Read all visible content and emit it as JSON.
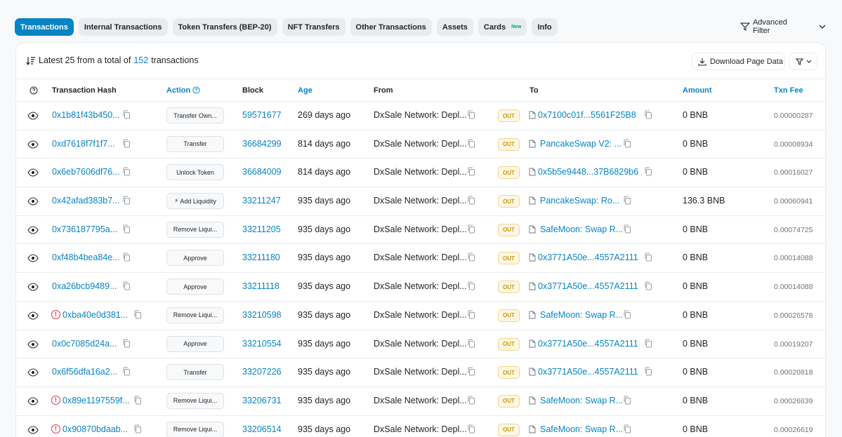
{
  "tabs": [
    {
      "label": "Transactions",
      "active": true
    },
    {
      "label": "Internal Transactions"
    },
    {
      "label": "Token Transfers (BEP-20)"
    },
    {
      "label": "NFT Transfers"
    },
    {
      "label": "Other Transactions"
    },
    {
      "label": "Assets"
    },
    {
      "label": "Cards",
      "badge": "New"
    },
    {
      "label": "Info"
    }
  ],
  "advanced_filter_label": "Advanced Filter",
  "summary": {
    "prefix": "Latest 25 from a total of",
    "count": "152",
    "suffix": "transactions"
  },
  "download_label": "Download Page Data",
  "columns": {
    "hash": "Transaction Hash",
    "action": "Action",
    "block": "Block",
    "age": "Age",
    "from": "From",
    "to": "To",
    "amount": "Amount",
    "fee": "Txn Fee"
  },
  "rows": [
    {
      "hash": "0x1b81f43b450...",
      "error": false,
      "action": "Transfer Own...",
      "block": "59571677",
      "age": "269 days ago",
      "from": "DxSale Network: Depl...",
      "direction": "OUT",
      "to": "0x7100c01f...5561F25B8",
      "to_is_contract": false,
      "amount": "0 BNB",
      "fee": "0.00000287"
    },
    {
      "hash": "0xd7618f7f1f7...",
      "error": false,
      "action": "Transfer",
      "block": "36684299",
      "age": "814 days ago",
      "from": "DxSale Network: Depl...",
      "direction": "OUT",
      "to": "PancakeSwap V2: ...",
      "to_is_contract": true,
      "amount": "0 BNB",
      "fee": "0.00008934"
    },
    {
      "hash": "0x6eb7606df76...",
      "error": false,
      "action": "Unlock Token",
      "block": "36684009",
      "age": "814 days ago",
      "from": "DxSale Network: Depl...",
      "direction": "OUT",
      "to": "0x5b5e9448...37B6829b6",
      "to_is_contract": false,
      "amount": "0 BNB",
      "fee": "0.00016027"
    },
    {
      "hash": "0x42afad383b7...",
      "error": false,
      "action": "Add Liquidity",
      "action_icon": true,
      "block": "33211247",
      "age": "935 days ago",
      "from": "DxSale Network: Depl...",
      "direction": "OUT",
      "to": "PancakeSwap: Ro...",
      "to_is_contract": true,
      "amount": "136.3 BNB",
      "fee": "0.00060941"
    },
    {
      "hash": "0x736187795a...",
      "error": false,
      "action": "Remove Liqui...",
      "block": "33211205",
      "age": "935 days ago",
      "from": "DxSale Network: Depl...",
      "direction": "OUT",
      "to": "SafeMoon: Swap R...",
      "to_is_contract": true,
      "amount": "0 BNB",
      "fee": "0.00074725"
    },
    {
      "hash": "0xf48b4bea84e...",
      "error": false,
      "action": "Approve",
      "block": "33211180",
      "age": "935 days ago",
      "from": "DxSale Network: Depl...",
      "direction": "OUT",
      "to": "0x3771A50e...4557A2111",
      "to_is_contract": false,
      "amount": "0 BNB",
      "fee": "0.00014088"
    },
    {
      "hash": "0xa26bcb9489...",
      "error": false,
      "action": "Approve",
      "block": "33211118",
      "age": "935 days ago",
      "from": "DxSale Network: Depl...",
      "direction": "OUT",
      "to": "0x3771A50e...4557A2111",
      "to_is_contract": false,
      "amount": "0 BNB",
      "fee": "0.00014088"
    },
    {
      "hash": "0xba40e0d381...",
      "error": true,
      "action": "Remove Liqui...",
      "block": "33210598",
      "age": "935 days ago",
      "from": "DxSale Network: Depl...",
      "direction": "OUT",
      "to": "SafeMoon: Swap R...",
      "to_is_contract": true,
      "amount": "0 BNB",
      "fee": "0.00026578"
    },
    {
      "hash": "0x0c7085d24a...",
      "error": false,
      "action": "Approve",
      "block": "33210554",
      "age": "935 days ago",
      "from": "DxSale Network: Depl...",
      "direction": "OUT",
      "to": "0x3771A50e...4557A2111",
      "to_is_contract": false,
      "amount": "0 BNB",
      "fee": "0.00019207"
    },
    {
      "hash": "0x6f56dfa16a2...",
      "error": false,
      "action": "Transfer",
      "block": "33207226",
      "age": "935 days ago",
      "from": "DxSale Network: Depl...",
      "direction": "OUT",
      "to": "0x3771A50e...4557A2111",
      "to_is_contract": false,
      "amount": "0 BNB",
      "fee": "0.00020818"
    },
    {
      "hash": "0x89e1197559f...",
      "error": true,
      "action": "Remove Liqui...",
      "block": "33206731",
      "age": "935 days ago",
      "from": "DxSale Network: Depl...",
      "direction": "OUT",
      "to": "SafeMoon: Swap R...",
      "to_is_contract": true,
      "amount": "0 BNB",
      "fee": "0.00026639"
    },
    {
      "hash": "0x90870bdaab...",
      "error": true,
      "action": "Remove Liqui...",
      "block": "33206514",
      "age": "935 days ago",
      "from": "DxSale Network: Depl...",
      "direction": "OUT",
      "to": "SafeMoon: Swap R...",
      "to_is_contract": true,
      "amount": "0 BNB",
      "fee": "0.00026619"
    }
  ],
  "colors": {
    "accent": "#0784c3",
    "error": "#dc3545",
    "out_badge": "#cc9a06"
  }
}
